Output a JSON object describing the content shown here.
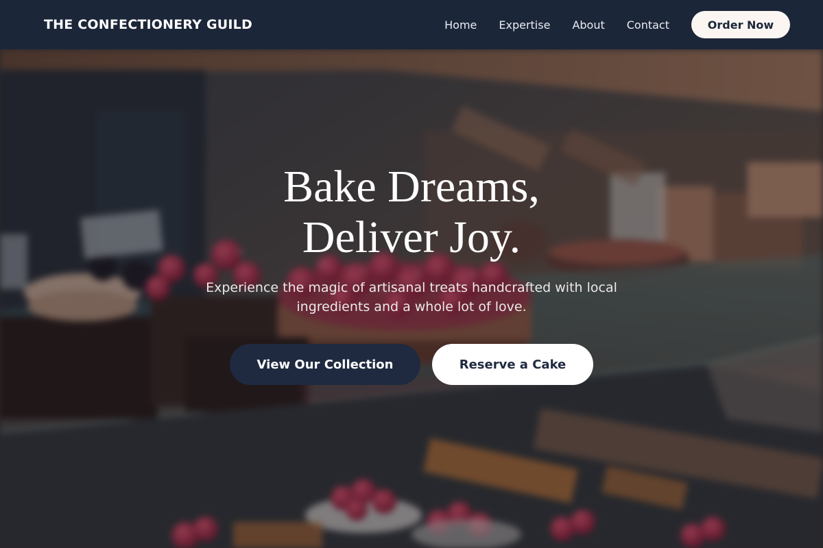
{
  "nav": {
    "brand": "THE CONFECTIONERY GUILD",
    "links": [
      "Home",
      "Expertise",
      "About",
      "Contact"
    ],
    "cta_label": "Order Now"
  },
  "hero": {
    "headline_line1": "Bake Dreams,",
    "headline_line2": "Deliver Joy.",
    "subtext_line1": "Experience the magic of artisanal treats handcrafted with local",
    "subtext_line2": "ingredients and a whole lot of love.",
    "primary_cta": "View Our Collection",
    "secondary_cta": "Reserve a Cake",
    "background_image": "blurred bakery display case with berry tarts and cakes"
  },
  "colors": {
    "navbar_bg": "#1c2639",
    "primary_button_bg": "#1f2a40",
    "light_button_bg": "#fbf6f1",
    "accent_berry": "#c8304a"
  }
}
